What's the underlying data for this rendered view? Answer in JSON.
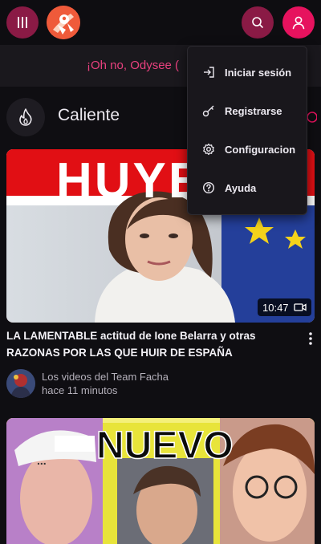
{
  "header": {
    "menu_icon": "menu-icon",
    "logo_icon": "odysee-logo",
    "search_icon": "search-icon",
    "user_icon": "user-icon"
  },
  "banner": {
    "text": "¡Oh no, Odysee ("
  },
  "section": {
    "title": "Caliente",
    "icon": "fire-icon"
  },
  "menu": {
    "items": [
      {
        "label": "Iniciar sesión",
        "icon": "sign-in-icon"
      },
      {
        "label": "Registrarse",
        "icon": "key-icon"
      },
      {
        "label": "Configuracion",
        "icon": "gear-icon"
      },
      {
        "label": "Ayuda",
        "icon": "help-icon"
      }
    ]
  },
  "videos": [
    {
      "thumbnail_text": "HUYE",
      "duration": "10:47",
      "title": "LA LAMENTABLE actitud de Ione Belarra y otras RAZONAS POR LAS QUE HUIR DE ESPAÑA",
      "channel": "Los videos del Team Facha",
      "time": "hace 11 minutos"
    },
    {
      "thumbnail_text": "NUEVO"
    }
  ],
  "colors": {
    "accent": "#e6125e",
    "accent_dark": "#8a1a45",
    "banner_text": "#e8407e"
  }
}
